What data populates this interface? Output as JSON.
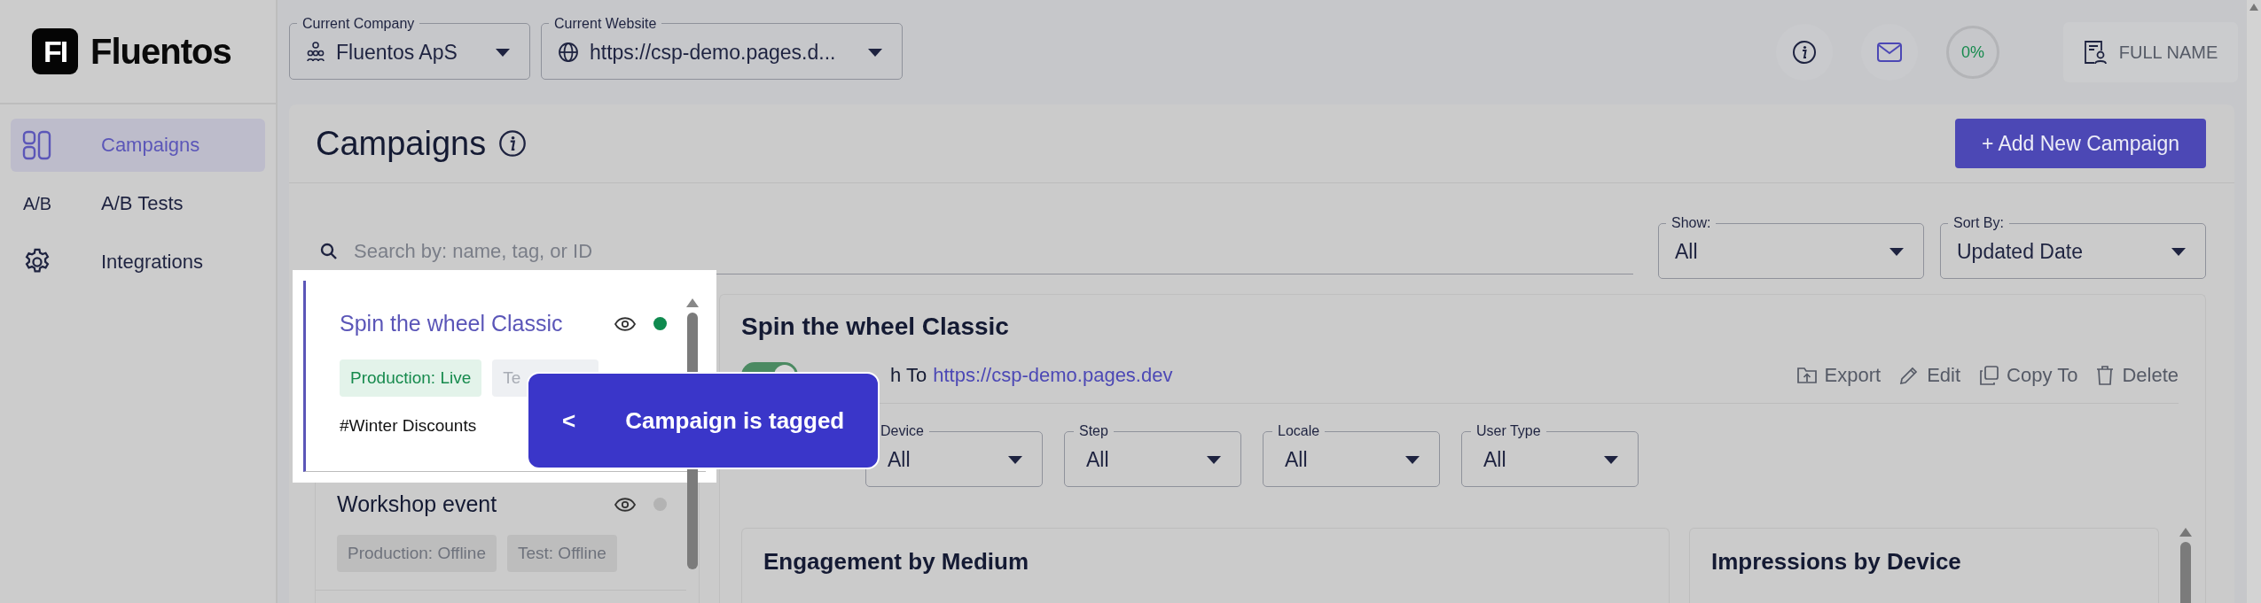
{
  "logo": {
    "mark": "FI",
    "text": "Fluentos"
  },
  "sidebar": {
    "items": [
      {
        "label": "Campaigns",
        "kind": "layout",
        "selected": true
      },
      {
        "label": "A/B Tests",
        "kind": "text",
        "icon_text": "A/B",
        "selected": false
      },
      {
        "label": "Integrations",
        "kind": "gear",
        "selected": false
      }
    ]
  },
  "header": {
    "selects": [
      {
        "label": "Current Company",
        "value": "Fluentos ApS",
        "kind": "company"
      },
      {
        "label": "Current Website",
        "value": "https://csp-demo.pages.d...",
        "kind": "globe"
      }
    ],
    "progress": "0%",
    "user": "FULL NAME"
  },
  "page": {
    "title": "Campaigns",
    "add_button": "+ Add New Campaign",
    "search": {
      "placeholder": "Search by: name, tag, or ID"
    },
    "filters": [
      {
        "label": "Show:",
        "value": "All"
      },
      {
        "label": "Sort By:",
        "value": "Updated Date"
      }
    ]
  },
  "campaigns": [
    {
      "name": "Spin the wheel Classic",
      "selected": true,
      "color": "#0f8a4f",
      "tags": [
        {
          "label": "Production: Live",
          "kind": "live"
        },
        {
          "label": "Te",
          "kind": "test"
        }
      ],
      "hashtag": "#Winter Discounts"
    },
    {
      "name": "Workshop event",
      "selected": false,
      "color": "#b3b3b3",
      "tags": [
        {
          "label": "Production: Offline",
          "kind": "offline"
        },
        {
          "label": "Test: Offline",
          "kind": "offline"
        }
      ]
    }
  ],
  "detail": {
    "title": "Spin the wheel Classic",
    "switch": {
      "on": true,
      "label": "h To",
      "link": "https://csp-demo.pages.dev"
    },
    "actions": [
      {
        "label": "Export",
        "kind": "export"
      },
      {
        "label": "Edit",
        "kind": "edit"
      },
      {
        "label": "Copy To",
        "kind": "copy"
      },
      {
        "label": "Delete",
        "kind": "delete"
      }
    ],
    "filters": [
      {
        "label": "Device",
        "value": "All"
      },
      {
        "label": "Step",
        "value": "All"
      },
      {
        "label": "Locale",
        "value": "All"
      },
      {
        "label": "User Type",
        "value": "All"
      }
    ],
    "cards": [
      {
        "title": "Engagement by Medium"
      },
      {
        "title": "Impressions by Device"
      }
    ]
  },
  "tour": {
    "back": "<",
    "text": "Campaign is tagged"
  }
}
